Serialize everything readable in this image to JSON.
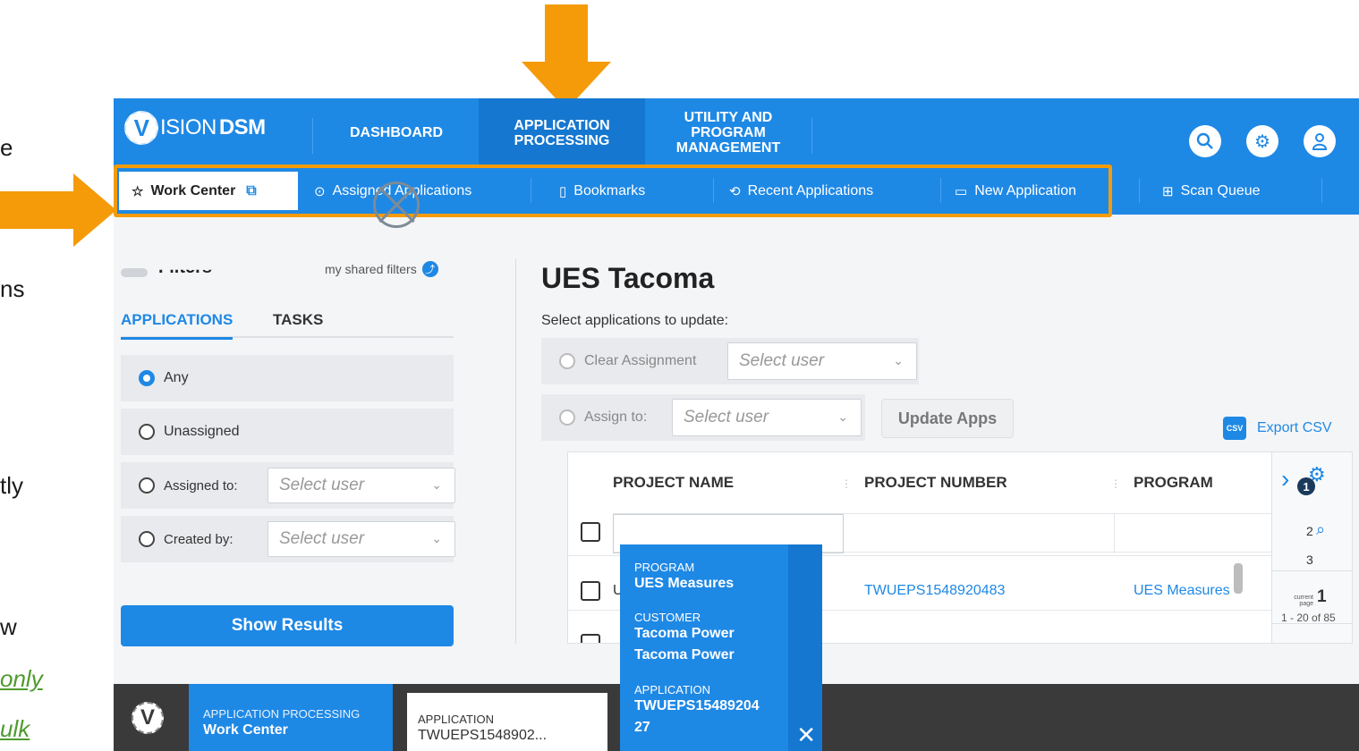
{
  "slide_fragments": [
    "e",
    "ns",
    "tly",
    "w",
    "only",
    "ulk"
  ],
  "colors": {
    "primary": "#1e88e5",
    "annotation_orange": "#f59b0a",
    "dark_bar": "#3a3a3a"
  },
  "topbar": {
    "logo_prefix": "V",
    "logo_word": "ISION",
    "logo_suffix": "DSM",
    "nav": [
      "DASHBOARD",
      "APPLICATION PROCESSING",
      "UTILITY AND PROGRAM MANAGEMENT"
    ],
    "icons": [
      "search-icon",
      "settings-gear-icon",
      "user-profile-icon"
    ]
  },
  "subnav": {
    "work_center": "Work Center",
    "assigned": "Assigned Applications",
    "bookmarks": "Bookmarks",
    "recent": "Recent Applications",
    "new_app": "New Application",
    "scan_queue": "Scan Queue"
  },
  "filters": {
    "label": "Filters",
    "shared": "my shared filters",
    "tabs": [
      "APPLICATIONS",
      "TASKS"
    ],
    "options": {
      "any": "Any",
      "unassigned": "Unassigned",
      "assigned_to": "Assigned to:",
      "created_by": "Created by:"
    },
    "select_placeholder": "Select user",
    "show_results": "Show Results"
  },
  "main": {
    "title": "UES Tacoma",
    "select_label": "Select applications to update:",
    "clear_assignment": "Clear Assignment",
    "assign_to": "Assign to:",
    "select_placeholder": "Select user",
    "update_button": "Update Apps",
    "export_csv": "Export CSV",
    "export_icon_label": "CSV"
  },
  "table": {
    "columns": [
      "PROJECT NAME",
      "PROJECT NUMBER",
      "PROGRAM"
    ],
    "rows": [
      {
        "name": "U",
        "number": "TWUEPS1548920483",
        "program": "UES Measures"
      }
    ],
    "pagination": {
      "badge": "1",
      "page2": "2",
      "page3": "3",
      "current_label": "current page",
      "current": "1",
      "range": "1 - 20 of 85"
    }
  },
  "popup": {
    "program_label": "PROGRAM",
    "program": "UES Measures",
    "customer_label": "CUSTOMER",
    "customer1": "Tacoma Power",
    "customer2": "Tacoma Power",
    "application_label": "APPLICATION",
    "application1": "TWUEPS15489204",
    "application2": "27"
  },
  "bottombar": {
    "active_line1": "APPLICATION PROCESSING",
    "active_line2": "Work Center",
    "tab_line1": "APPLICATION",
    "tab_line2": "TWUEPS1548902..."
  }
}
